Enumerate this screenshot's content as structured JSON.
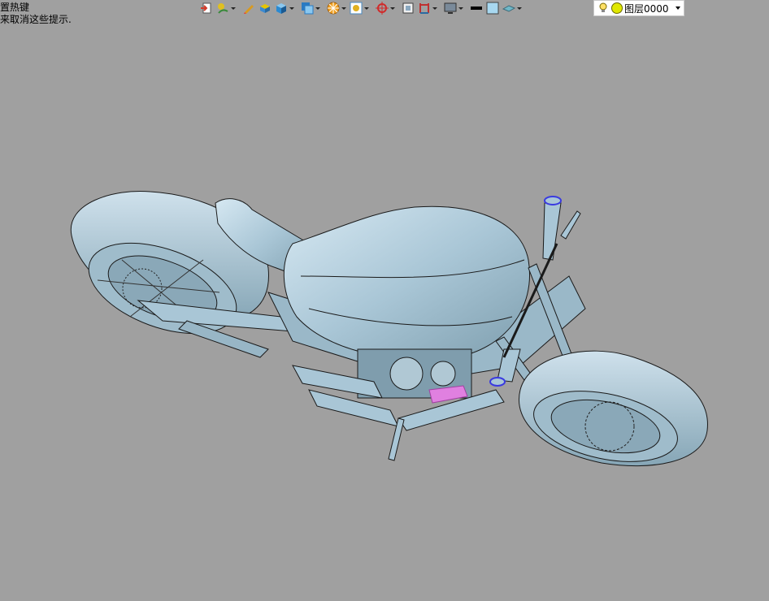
{
  "hints": {
    "line1": "置热键",
    "line2": "来取消这些提示."
  },
  "toolbar": {
    "icons": [
      {
        "name": "exit-icon",
        "color": "#d23a2a"
      },
      {
        "name": "sketch-icon",
        "color": "#3a8a3a"
      },
      {
        "name": "pencil-icon",
        "color": "#d89a20"
      },
      {
        "name": "extrude-icon",
        "color": "#e6c400"
      },
      {
        "name": "box-icon",
        "color": "#2a8ad2"
      },
      {
        "name": "view-cube-icon",
        "color": "#2a7ac2"
      },
      {
        "name": "orient-icon",
        "color": "#e08a10"
      },
      {
        "name": "frame-icon",
        "color": "#d0a020"
      },
      {
        "name": "target-icon",
        "color": "#d02a2a"
      },
      {
        "name": "square-icon",
        "color": "#404040"
      },
      {
        "name": "measure-icon",
        "color": "#c03030"
      },
      {
        "name": "display-icon",
        "color": "#303030"
      },
      {
        "name": "line-color-icon",
        "color": "#000000"
      },
      {
        "name": "fill-color-icon",
        "color": "#a8d8f0"
      },
      {
        "name": "material-icon",
        "color": "#70b8c8"
      }
    ]
  },
  "layer": {
    "name": "图层0000",
    "bulb_color": "#ffe066",
    "dot_color": "#e0e800"
  },
  "model": {
    "body_color": "#a9c6d6",
    "highlight_color": "#e080e0",
    "accent_color": "#3a3ae0",
    "background": "#a0a0a0"
  }
}
